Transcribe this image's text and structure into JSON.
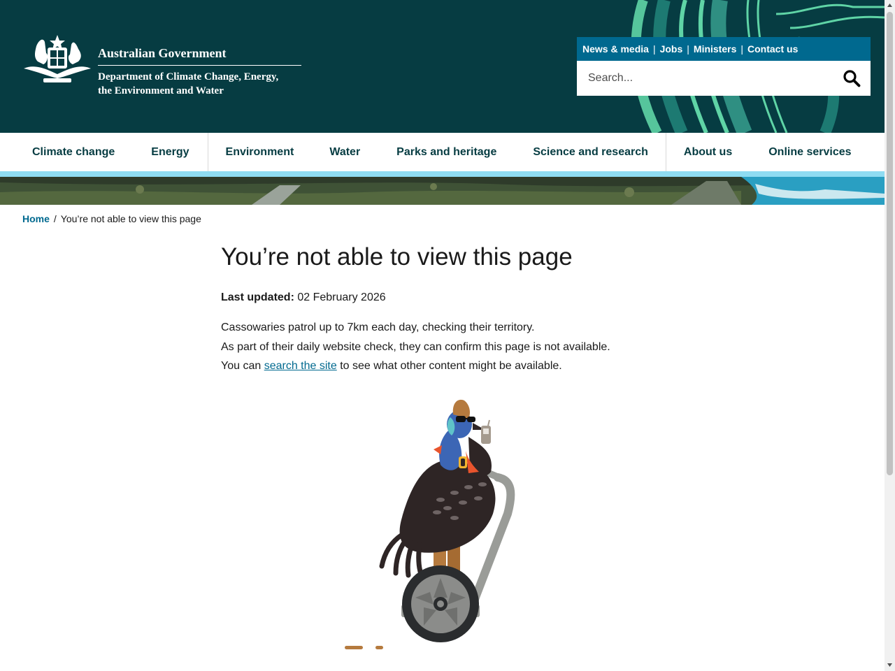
{
  "header": {
    "gov_name": "Australian Government",
    "dept_line1": "Department of Climate Change, Energy,",
    "dept_line2": "the Environment and Water",
    "bg_color": "#063c42",
    "accent_color": "#00698f"
  },
  "utility": {
    "links": [
      "News & media",
      "Jobs",
      "Ministers",
      "Contact us"
    ],
    "separator": "|"
  },
  "search": {
    "placeholder": "Search...",
    "icon": "search-icon"
  },
  "nav": {
    "items": [
      "Climate change",
      "Energy",
      "Environment",
      "Water",
      "Parks and heritage",
      "Science and research",
      "About us",
      "Online services"
    ]
  },
  "breadcrumb": {
    "home": "Home",
    "separator": "/",
    "current": "You’re not able to view this page"
  },
  "main": {
    "title": "You’re not able to view this page",
    "last_updated_label": "Last updated:",
    "last_updated_value": "02 February 2026",
    "line1": "Cassowaries patrol up to 7km each day, checking their territory.",
    "line2": "As part of their daily website check, they can confirm this page is not available.",
    "line3_pre": "You can ",
    "line3_link": "search the site",
    "line3_post": " to see what other content might be available."
  }
}
